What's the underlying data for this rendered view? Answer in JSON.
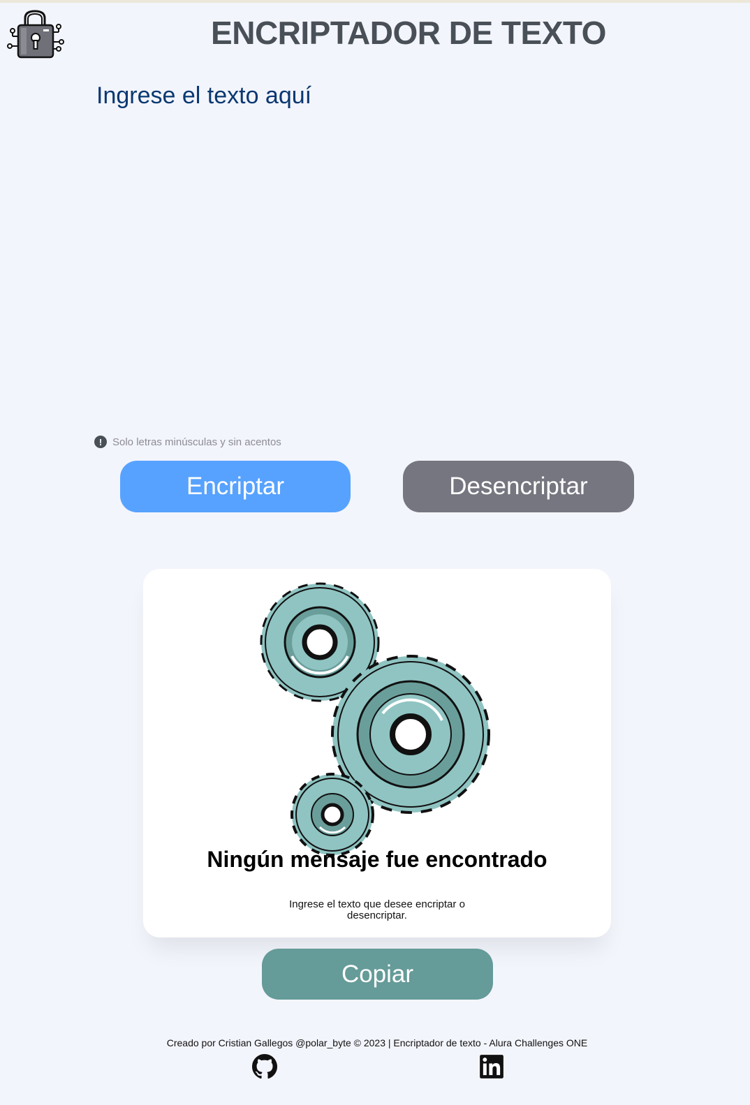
{
  "app": {
    "title": "ENCRIPTADOR DE TEXTO",
    "logo_icon": "padlock-circuit-icon"
  },
  "input": {
    "placeholder": "Ingrese el texto aquí",
    "value": ""
  },
  "hint": {
    "icon": "exclamation-circle-icon",
    "text": "Solo letras minúsculas y sin acentos"
  },
  "buttons": {
    "encrypt_label": "Encriptar",
    "decrypt_label": "Desencriptar",
    "copy_label": "Copiar"
  },
  "output": {
    "illustration_icon": "gears-icon",
    "title": "Ningún mensaje fue encontrado",
    "subtitle": "Ingrese el texto que desee encriptar o desencriptar."
  },
  "footer": {
    "text": "Creado por Cristian Gallegos @polar_byte © 2023 | Encriptador de texto - Alura Challenges ONE",
    "links": [
      {
        "icon": "github-icon"
      },
      {
        "icon": "linkedin-icon"
      }
    ]
  },
  "colors": {
    "background": "#f3f5fc",
    "title": "#495057",
    "input_text": "#0a3871",
    "encrypt": "#57a2ff",
    "decrypt": "#767680",
    "copy": "#659b98"
  }
}
